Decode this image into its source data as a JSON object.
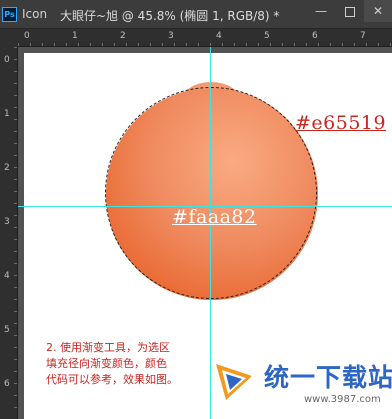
{
  "titlebar": {
    "app_logo": "Ps",
    "tab_label": "Icon",
    "document_title": "大眼仔~旭 @ 45.8% (椭圆 1, RGB/8) *",
    "minimize_label": "—",
    "close_label": "✕"
  },
  "rulers": {
    "horizontal": [
      "0",
      "1",
      "2",
      "3",
      "4",
      "5",
      "6",
      "7"
    ],
    "vertical": [
      "0",
      "1",
      "2",
      "3",
      "4",
      "5",
      "6"
    ]
  },
  "canvas": {
    "color_label_outer": "#e65519",
    "color_label_inner": "#faaa82",
    "instructions": [
      "2. 使用渐变工具，为选区",
      "填充径向渐变颜色，颜色",
      "代码可以参考，效果如图。"
    ],
    "colors": {
      "outer": "#e65519",
      "inner": "#faaa82",
      "guide": "#3be4e4",
      "note": "#c8261e"
    }
  },
  "watermark": {
    "title": "统一下载站",
    "url": "www.3987.com"
  }
}
